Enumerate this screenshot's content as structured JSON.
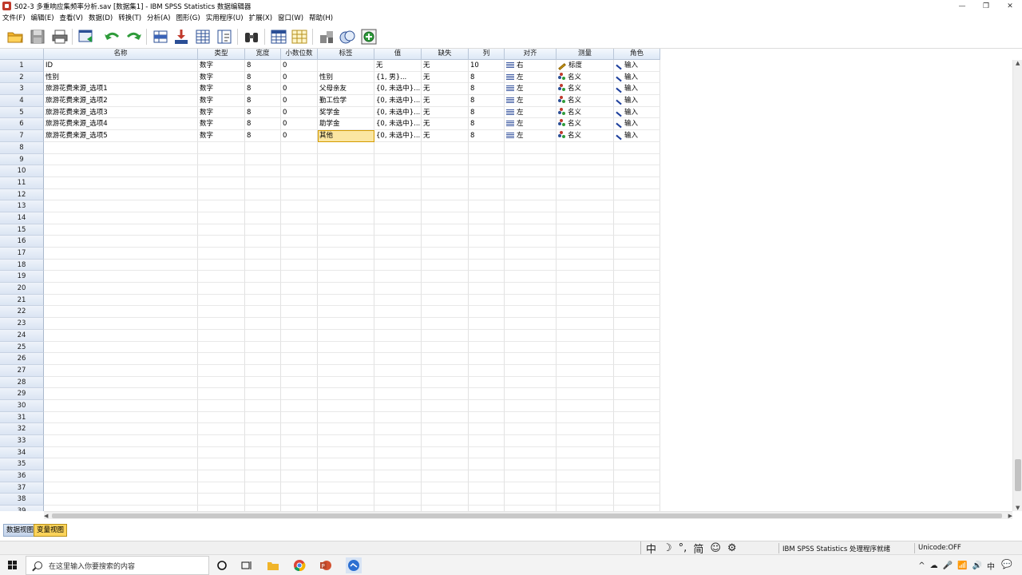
{
  "window": {
    "title": "S02-3 多重响应集频率分析.sav [数据集1] - IBM SPSS Statistics 数据编辑器",
    "controls": [
      "—",
      "❐",
      "✕"
    ]
  },
  "menu": [
    "文件(F)",
    "编辑(E)",
    "查看(V)",
    "数据(D)",
    "转换(T)",
    "分析(A)",
    "图形(G)",
    "实用程序(U)",
    "扩展(X)",
    "窗口(W)",
    "帮助(H)"
  ],
  "toolbar": {
    "icons": [
      "open-folder-icon",
      "save-icon",
      "print-icon",
      "recall-dialog-icon",
      "undo-icon",
      "redo-icon",
      "goto-case-icon",
      "goto-variable-icon",
      "variables-icon",
      "run-descriptives-icon",
      "find-icon",
      "insert-cases-icon",
      "insert-variable-icon",
      "split-file-icon",
      "value-labels-icon",
      "use-sets-icon"
    ]
  },
  "grid": {
    "columns": [
      "名称",
      "类型",
      "宽度",
      "小数位数",
      "标签",
      "值",
      "缺失",
      "列",
      "对齐",
      "测量",
      "角色"
    ],
    "rows": [
      {
        "num": "1",
        "name": "ID",
        "type": "数字",
        "width": "8",
        "decimals": "0",
        "label": "",
        "values": "无",
        "missing": "无",
        "columns": "10",
        "align": "右",
        "measure": "标度",
        "role": "输入"
      },
      {
        "num": "2",
        "name": "性别",
        "type": "数字",
        "width": "8",
        "decimals": "0",
        "label": "性别",
        "values": "{1, 男}...",
        "missing": "无",
        "columns": "8",
        "align": "左",
        "measure": "名义",
        "role": "输入"
      },
      {
        "num": "3",
        "name": "旅游花费来源_选项1",
        "type": "数字",
        "width": "8",
        "decimals": "0",
        "label": "父母亲友",
        "values": "{0, 未选中}...",
        "missing": "无",
        "columns": "8",
        "align": "左",
        "measure": "名义",
        "role": "输入"
      },
      {
        "num": "4",
        "name": "旅游花费来源_选项2",
        "type": "数字",
        "width": "8",
        "decimals": "0",
        "label": "勤工俭学",
        "values": "{0, 未选中}...",
        "missing": "无",
        "columns": "8",
        "align": "左",
        "measure": "名义",
        "role": "输入"
      },
      {
        "num": "5",
        "name": "旅游花费来源_选项3",
        "type": "数字",
        "width": "8",
        "decimals": "0",
        "label": "奖学金",
        "values": "{0, 未选中}...",
        "missing": "无",
        "columns": "8",
        "align": "左",
        "measure": "名义",
        "role": "输入"
      },
      {
        "num": "6",
        "name": "旅游花费来源_选项4",
        "type": "数字",
        "width": "8",
        "decimals": "0",
        "label": "助学金",
        "values": "{0, 未选中}...",
        "missing": "无",
        "columns": "8",
        "align": "左",
        "measure": "名义",
        "role": "输入"
      },
      {
        "num": "7",
        "name": "旅游花费来源_选项5",
        "type": "数字",
        "width": "8",
        "decimals": "0",
        "label": "其他",
        "values": "{0, 未选中}...",
        "missing": "无",
        "columns": "8",
        "align": "左",
        "measure": "名义",
        "role": "输入"
      }
    ],
    "empty_rows": [
      "8",
      "9",
      "10",
      "11",
      "12",
      "13",
      "14",
      "15",
      "16",
      "17",
      "18",
      "19",
      "20",
      "21",
      "22",
      "23",
      "24",
      "25",
      "26",
      "27",
      "28",
      "29",
      "30",
      "31",
      "32",
      "33",
      "34",
      "35",
      "36",
      "37",
      "38",
      "39"
    ],
    "selected_cell": {
      "row": 7,
      "col": "label"
    }
  },
  "tabs": {
    "data_view": "数据视图",
    "variable_view": "变量视图",
    "active": "variable_view"
  },
  "status": {
    "ime": [
      "中",
      "☽",
      "°,",
      "简",
      "☺",
      "⚙"
    ],
    "processor": "IBM SPSS Statistics 处理程序就绪",
    "unicode": "Unicode:OFF"
  },
  "taskbar": {
    "search_placeholder": "在这里输入你要搜索的内容",
    "tray": [
      "^",
      "☁",
      "🎤",
      "📶",
      "🔊",
      "中",
      "💬"
    ]
  },
  "colors": {
    "header_bg": "#dde8f6",
    "selected_cell": "#fbe6a2",
    "active_tab": "#fbd35a",
    "accent_blue": "#1d3f9c"
  }
}
